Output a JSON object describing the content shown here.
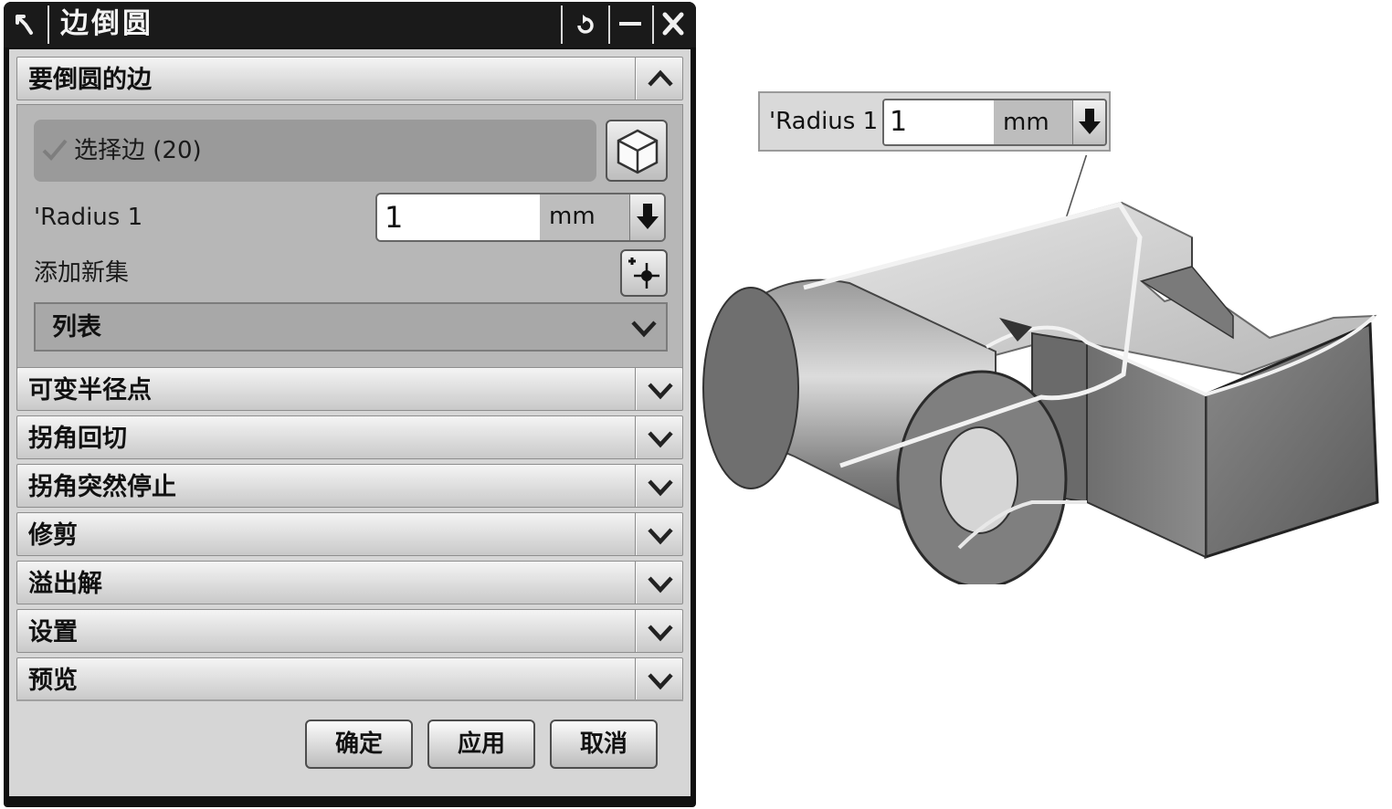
{
  "dialog": {
    "title": "边倒圆",
    "titlebar_buttons": [
      "reset-icon",
      "minimize-icon",
      "close-icon"
    ]
  },
  "edges_group": {
    "header": "要倒圆的边",
    "select_label": "选择边 (20)",
    "radius_label": "'Radius 1",
    "radius_value": "1",
    "radius_unit": "mm",
    "add_set_label": "添加新集",
    "list_label": "列表"
  },
  "collapsed_groups": [
    "可变半径点",
    "拐角回切",
    "拐角突然停止",
    "修剪",
    "溢出解",
    "设置",
    "预览"
  ],
  "buttons": {
    "ok": "确定",
    "apply": "应用",
    "cancel": "取消"
  },
  "callout": {
    "label": "'Radius 1",
    "value": "1",
    "unit": "mm"
  }
}
